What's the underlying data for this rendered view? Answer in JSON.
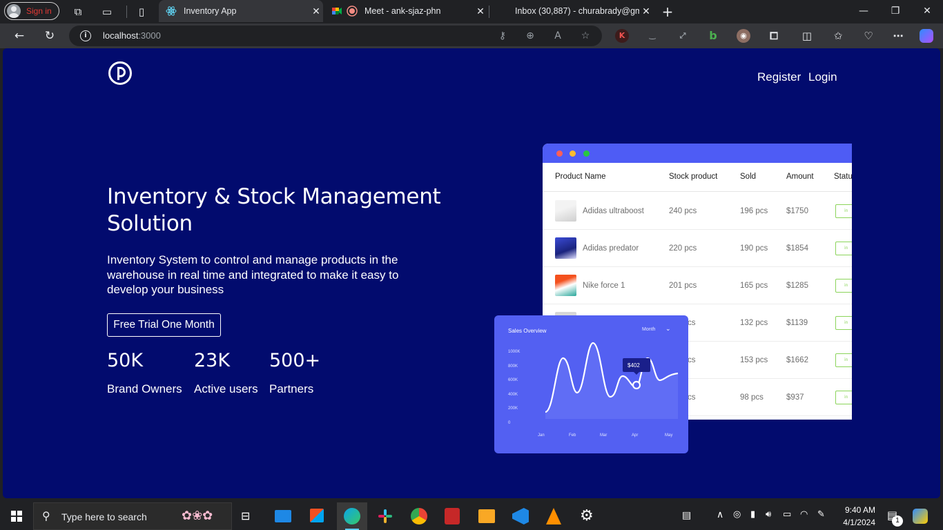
{
  "browser": {
    "profile_label": "Sign in",
    "tabs": [
      {
        "title": "Inventory App",
        "active": true,
        "favicon": "react-icon"
      },
      {
        "title": "Meet - ank-sjaz-phn",
        "active": false,
        "favicon": "meet-icon"
      },
      {
        "title": "Inbox (30,887) - churabrady@gm",
        "active": false,
        "favicon": "gmail-icon"
      }
    ],
    "url_host": "localhost",
    "url_port": ":3000"
  },
  "page": {
    "nav": {
      "register": "Register",
      "login": "Login"
    },
    "hero": {
      "title": "Inventory & Stock Management Solution",
      "subtitle": "Inventory System to control and manage products in the warehouse in real time and integrated to make it easy to develop your business",
      "cta": "Free Trial One Month"
    },
    "stats": [
      {
        "value": "50K",
        "label": "Brand Owners"
      },
      {
        "value": "23K",
        "label": "Active users"
      },
      {
        "value": "500+",
        "label": "Partners"
      }
    ],
    "table": {
      "columns": [
        "Product Name",
        "Stock product",
        "Sold",
        "Amount",
        "Statu"
      ],
      "rows": [
        {
          "name": "Adidas ultraboost",
          "stock": "240 pcs",
          "sold": "196 pcs",
          "amount": "$1750"
        },
        {
          "name": "Adidas predator",
          "stock": "220 pcs",
          "sold": "190 pcs",
          "amount": "$1854"
        },
        {
          "name": "Nike force 1",
          "stock": "201 pcs",
          "sold": "165 pcs",
          "amount": "$1285"
        },
        {
          "name": "",
          "stock": "cs",
          "sold": "132 pcs",
          "amount": "$1139"
        },
        {
          "name": "",
          "stock": "cs",
          "sold": "153 pcs",
          "amount": "$1662"
        },
        {
          "name": "",
          "stock": "cs",
          "sold": "98 pcs",
          "amount": "$937"
        }
      ]
    },
    "sales": {
      "title": "Sales Overview",
      "period": "Month",
      "tooltip": "$402",
      "y_ticks": [
        "1000K",
        "800K",
        "600K",
        "400K",
        "200K",
        "0"
      ],
      "x_ticks": [
        "Jan",
        "Feb",
        "Mar",
        "Apr",
        "May"
      ]
    }
  },
  "taskbar": {
    "search_placeholder": "Type here to search",
    "time": "9:40 AM",
    "date": "4/1/2024",
    "notification_count": "1"
  },
  "colors": {
    "page_bg": "#020b6e",
    "accent": "#4e5cf5",
    "card_accent": "#5360f2"
  }
}
